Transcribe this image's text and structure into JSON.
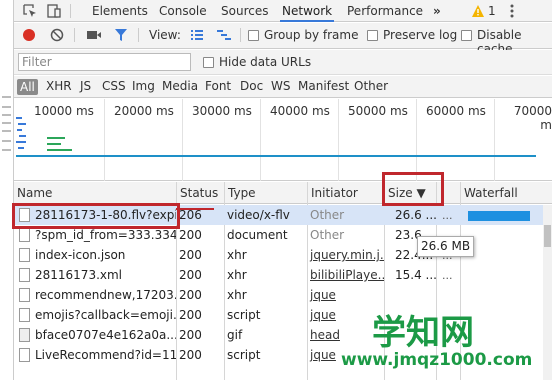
{
  "tabs": {
    "elements": "Elements",
    "console": "Console",
    "sources": "Sources",
    "network": "Network",
    "performance": "Performance",
    "more": "»",
    "warn_count": "1"
  },
  "toolbar": {
    "view_label": "View:",
    "group_by_frame": "Group by frame",
    "preserve_log": "Preserve log",
    "disable_cache": "Disable cache"
  },
  "filter": {
    "placeholder": "Filter",
    "hide_data_urls": "Hide data URLs"
  },
  "types": {
    "all": "All",
    "xhr": "XHR",
    "js": "JS",
    "css": "CSS",
    "img": "Img",
    "media": "Media",
    "font": "Font",
    "doc": "Doc",
    "ws": "WS",
    "manifest": "Manifest",
    "other": "Other"
  },
  "timeline": [
    "10000 ms",
    "20000 ms",
    "30000 ms",
    "40000 ms",
    "50000 ms",
    "60000 ms",
    "70000 m"
  ],
  "columns": {
    "name": "Name",
    "status": "Status",
    "type": "Type",
    "initiator": "Initiator",
    "size": "Size ▼",
    "waterfall": "Waterfall"
  },
  "rows": [
    {
      "name": "28116173-1-80.flv?expi...",
      "status": "206",
      "type": "video/x-flv",
      "initiator": "Other",
      "size": "26.6 ..."
    },
    {
      "name": "?spm_id_from=333.334...",
      "status": "200",
      "type": "document",
      "initiator": "Other",
      "size": "23.6..."
    },
    {
      "name": "index-icon.json",
      "status": "200",
      "type": "xhr",
      "initiator": "jquery.min.j...",
      "size": "22.4..."
    },
    {
      "name": "28116173.xml",
      "status": "200",
      "type": "xhr",
      "initiator": "bilibiliPlaye...",
      "size": "15.4 ..."
    },
    {
      "name": "recommendnew,17203...",
      "status": "200",
      "type": "xhr",
      "initiator": "jque",
      "size": ""
    },
    {
      "name": "emojis?callback=emoji...",
      "status": "200",
      "type": "script",
      "initiator": "jque",
      "size": ""
    },
    {
      "name": "bface0707e4e162a0a...",
      "status": "200",
      "type": "gif",
      "initiator": "head",
      "size": ""
    },
    {
      "name": "LiveRecommend?id=11...",
      "status": "200",
      "type": "script",
      "initiator": "jque",
      "size": ""
    }
  ],
  "tooltip": "26.6 MB",
  "watermark": {
    "title": "学知网",
    "url": "www.jmqz1000.com"
  },
  "colors": {
    "highlight": "#c0272d",
    "accent": "#3879d9",
    "waterfall_bar": "#1e90e0",
    "watermark": "#1c9a46"
  }
}
